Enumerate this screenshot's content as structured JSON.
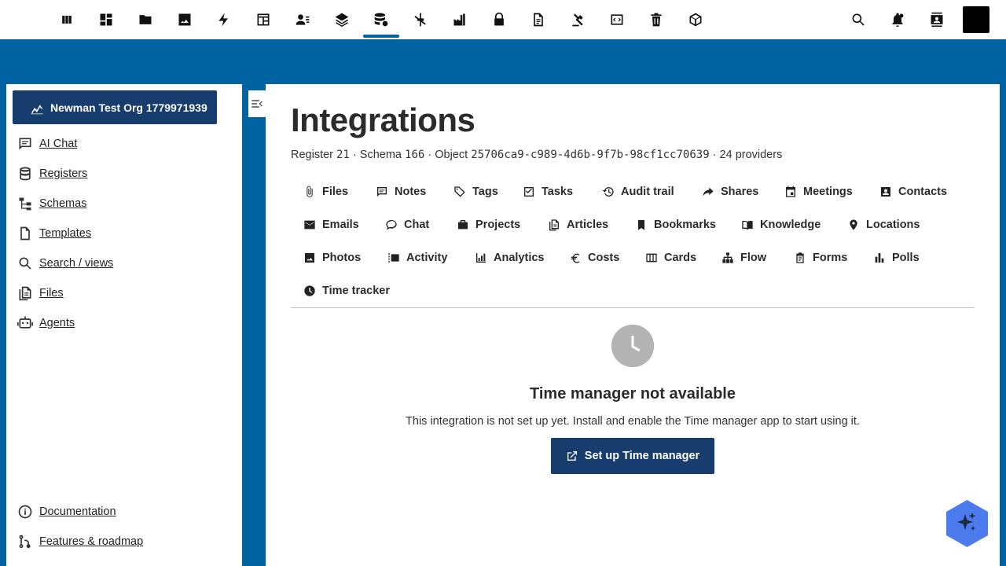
{
  "topbar": {
    "apps": [
      {
        "icon": "columns-icon"
      },
      {
        "icon": "dashboard-icon"
      },
      {
        "icon": "folder-icon"
      },
      {
        "icon": "image-icon"
      },
      {
        "icon": "lightning-icon"
      },
      {
        "icon": "table-icon"
      },
      {
        "icon": "contacts-list-icon"
      },
      {
        "icon": "layers-icon"
      },
      {
        "icon": "database-settings-icon",
        "active": true
      },
      {
        "icon": "crossed-tool-icon"
      },
      {
        "icon": "factory-icon"
      },
      {
        "icon": "lock-icon"
      },
      {
        "icon": "document-icon"
      },
      {
        "icon": "gavel-icon"
      },
      {
        "icon": "code-window-icon"
      },
      {
        "icon": "trash-icon"
      },
      {
        "icon": "cube-icon"
      }
    ],
    "right_icons": [
      "search-icon",
      "notifications-icon",
      "contacts-icon"
    ]
  },
  "sidebar": {
    "org_label": "Newman Test Org 1779971939",
    "items": [
      {
        "label": "AI Chat",
        "icon": "chat-icon"
      },
      {
        "label": "Registers",
        "icon": "database-icon"
      },
      {
        "label": "Schemas",
        "icon": "schema-tree-icon"
      },
      {
        "label": "Templates",
        "icon": "file-icon"
      },
      {
        "label": "Search / views",
        "icon": "search-icon"
      },
      {
        "label": "Files",
        "icon": "files-icon"
      },
      {
        "label": "Agents",
        "icon": "robot-icon"
      }
    ],
    "footer_items": [
      {
        "label": "Documentation",
        "icon": "info-icon"
      },
      {
        "label": "Features & roadmap",
        "icon": "roadmap-icon"
      }
    ]
  },
  "main": {
    "title": "Integrations",
    "meta": {
      "register_label": "Register",
      "register_value": "21",
      "schema_label": "Schema",
      "schema_value": "166",
      "object_label": "Object",
      "object_value": "25706ca9-c989-4d6b-9f7b-98cf1cc70639",
      "providers": "24 providers",
      "separator": "·"
    },
    "tabs": [
      {
        "label": "Files",
        "icon": "paperclip-icon"
      },
      {
        "label": "Notes",
        "icon": "note-icon"
      },
      {
        "label": "Tags",
        "icon": "tag-icon"
      },
      {
        "label": "Tasks",
        "icon": "checkbox-icon"
      },
      {
        "label": "Audit trail",
        "icon": "history-icon"
      },
      {
        "label": "Shares",
        "icon": "share-icon"
      },
      {
        "label": "Meetings",
        "icon": "calendar-icon"
      },
      {
        "label": "Contacts",
        "icon": "contact-card-icon"
      },
      {
        "label": "Emails",
        "icon": "mail-icon"
      },
      {
        "label": "Chat",
        "icon": "chat-bubble-icon"
      },
      {
        "label": "Projects",
        "icon": "briefcase-icon"
      },
      {
        "label": "Articles",
        "icon": "article-icon"
      },
      {
        "label": "Bookmarks",
        "icon": "bookmark-icon"
      },
      {
        "label": "Knowledge",
        "icon": "book-icon"
      },
      {
        "label": "Locations",
        "icon": "location-pin-icon"
      },
      {
        "label": "Photos",
        "icon": "photo-icon"
      },
      {
        "label": "Activity",
        "icon": "activity-icon"
      },
      {
        "label": "Analytics",
        "icon": "bar-chart-icon"
      },
      {
        "label": "Costs",
        "icon": "euro-icon"
      },
      {
        "label": "Cards",
        "icon": "cards-icon"
      },
      {
        "label": "Flow",
        "icon": "flow-icon"
      },
      {
        "label": "Forms",
        "icon": "form-icon"
      },
      {
        "label": "Polls",
        "icon": "poll-icon"
      },
      {
        "label": "Time tracker",
        "icon": "clock-icon",
        "active": true
      }
    ],
    "empty_state": {
      "icon": "clock-icon",
      "title": "Time manager not available",
      "description": "This integration is not set up yet. Install and enable the Time manager app to start using it.",
      "button_label": "Set up Time manager",
      "button_icon": "external-link-icon"
    }
  },
  "colors": {
    "background": "#0063a1",
    "primary_button": "#173d6e",
    "fab": "#4b7bec"
  }
}
